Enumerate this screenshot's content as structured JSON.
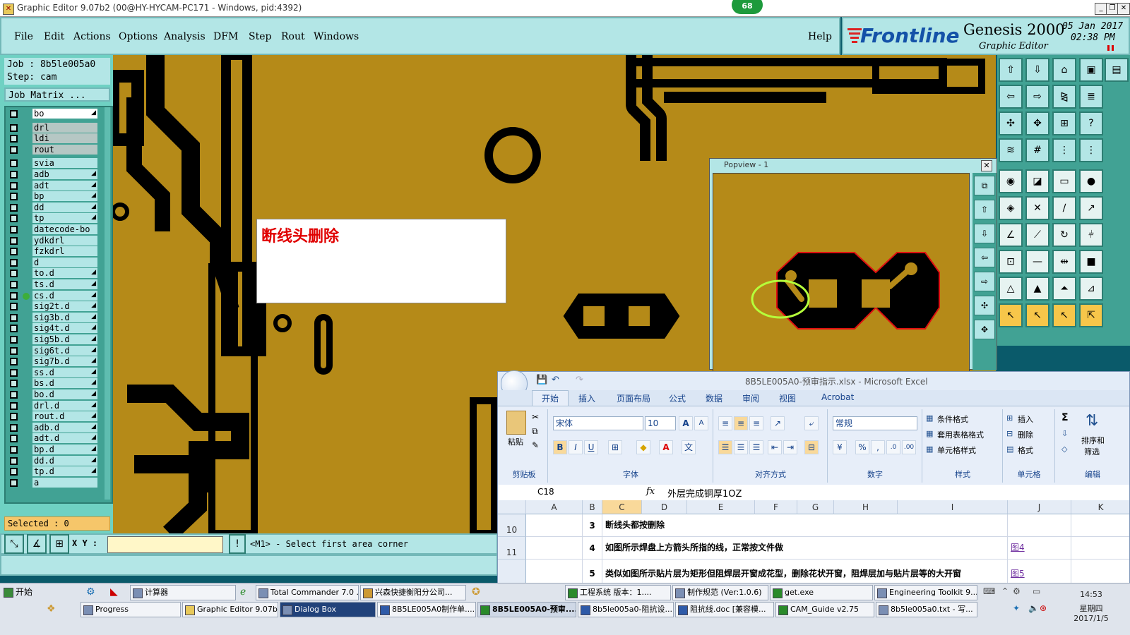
{
  "titlebar": {
    "title": "Graphic Editor 9.07b2 (00@HY-HYCAM-PC171 - Windows, pid:4392)",
    "badge": "68",
    "minimize": "_",
    "restore": "❐",
    "close": "✕"
  },
  "menu": {
    "items": [
      "File",
      "Edit",
      "Actions",
      "Options",
      "Analysis",
      "DFM",
      "Step",
      "Rout",
      "Windows"
    ],
    "help": "Help"
  },
  "brand": {
    "logo": "Frontline",
    "product": "Genesis 2000",
    "subtitle": "Graphic Editor",
    "date": "05 Jan 2017",
    "time": "02:38 PM"
  },
  "left": {
    "job": "Job : 8b5le005a0",
    "step": "Step: cam",
    "job_matrix": "Job Matrix ...",
    "layers": [
      "bo",
      "drl",
      "ldi",
      "rout",
      "svia",
      "adb",
      "adt",
      "bp",
      "dd",
      "tp",
      "datecode-bo",
      "ydkdrl",
      "fzkdrl",
      "d",
      "to.d",
      "ts.d",
      "cs.d",
      "sig2t.d",
      "sig3b.d",
      "sig4t.d",
      "sig5b.d",
      "sig6t.d",
      "sig7b.d",
      "ss.d",
      "bs.d",
      "bo.d",
      "drl.d",
      "rout.d",
      "adb.d",
      "adt.d",
      "bp.d",
      "dd.d",
      "tp.d",
      "a"
    ],
    "selected": "Selected : 0"
  },
  "coord": {
    "label": "X Y :",
    "value": "",
    "prompt": "<M1> - Select first area corner"
  },
  "note": {
    "text": "断线头删除"
  },
  "popview": {
    "title": "Popview - 1",
    "close": "✕"
  },
  "excel": {
    "title": "8B5LE005A0-预审指示.xlsx - Microsoft Excel",
    "tabs": [
      "开始",
      "插入",
      "页面布局",
      "公式",
      "数据",
      "审阅",
      "视图",
      "Acrobat"
    ],
    "clipboard": {
      "paste": "粘贴",
      "label": "剪贴板"
    },
    "font": {
      "name": "宋体",
      "size": "10",
      "label": "字体",
      "bold": "B",
      "italic": "I",
      "underline": "U",
      "grow": "A",
      "shrink": "A",
      "wen": "文"
    },
    "align": {
      "label": "对齐方式"
    },
    "number": {
      "format": "常规",
      "label": "数字",
      "percent": "%",
      "comma": ","
    },
    "styles": {
      "cond": "条件格式",
      "table": "套用表格格式",
      "cell": "单元格样式",
      "label": "样式"
    },
    "cells": {
      "insert": "插入",
      "delete": "删除",
      "format": "格式",
      "label": "单元格"
    },
    "edit": {
      "sigma": "Σ",
      "sort": "排序和",
      "filter": "筛选",
      "label": "编辑"
    },
    "namebox": "C18",
    "fx": "fx",
    "formula": "外层完成铜厚1OZ",
    "columns": [
      "A",
      "B",
      "C",
      "D",
      "E",
      "F",
      "G",
      "H",
      "I",
      "J",
      "K"
    ],
    "rows": [
      {
        "row": "10",
        "b": "3",
        "c": "断线头都按删除",
        "j": ""
      },
      {
        "row": "11",
        "b": "4",
        "c": "如图所示焊盘上方箭头所指的线，正常按文件做",
        "j": "图4"
      },
      {
        "row": "",
        "b": "5",
        "c": "类似如图所示贴片层为矩形但阻焊层开窗成花型，删除花状开窗，阻焊层加与贴片层等的大开窗",
        "j": "图5"
      }
    ]
  },
  "taskbar": {
    "start": "开始",
    "row1": [
      "计算器",
      "Total Commander 7.0 ...",
      "兴森快捷衡阳分公司...",
      "工程系统  版本：1....",
      "制作规范 (Ver:1.0.6)",
      "get.exe",
      "Engineering Toolkit 9...."
    ],
    "row2": [
      "Progress",
      "Graphic Editor 9.07b...",
      "Dialog Box",
      "8B5LE005A0制作单....",
      "8B5LE005A0-预审....",
      "8b5le005a0-阻抗设...",
      "阻抗线.doc [兼容模...",
      "CAM_Guide v2.75",
      "8b5le005a0.txt - 写..."
    ],
    "time": "14:53",
    "weekday": "星期四",
    "date": "2017/1/5"
  },
  "colors": {
    "copper": "#b58a18",
    "teal_panel": "#6fd1c3",
    "menu_bg": "#b3e6e6",
    "note_text": "#e00000",
    "excel_blue": "#15428b"
  }
}
